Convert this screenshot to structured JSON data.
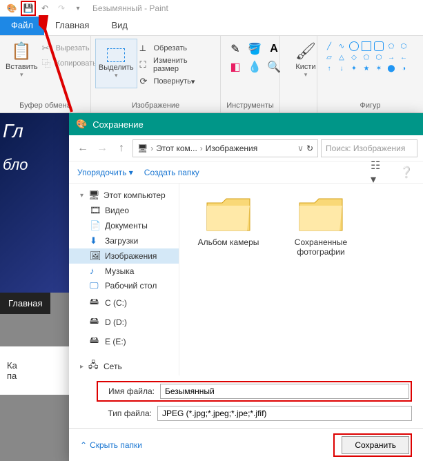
{
  "title": {
    "doc": "Безымянный",
    "app": "Paint"
  },
  "tabs": {
    "file": "Файл",
    "home": "Главная",
    "view": "Вид"
  },
  "ribbon": {
    "clipboard": {
      "paste": "Вставить",
      "cut": "Вырезать",
      "copy": "Копировать",
      "label": "Буфер обмена"
    },
    "image": {
      "select": "Выделить",
      "crop": "Обрезать",
      "resize": "Изменить размер",
      "rotate": "Повернуть",
      "label": "Изображение"
    },
    "tools": {
      "label": "Инструменты"
    },
    "brushes": {
      "label": "Кисти"
    },
    "shapes": {
      "label": "Фигур"
    }
  },
  "canvas": {
    "text1": "Гл",
    "text2": "бло",
    "tab": "Главная",
    "bottom1": "Ка",
    "bottom2": "па"
  },
  "dialog": {
    "title": "Сохранение",
    "breadcrumb": {
      "pc": "Этот ком...",
      "folder": "Изображения"
    },
    "search_placeholder": "Поиск: Изображения",
    "organize": "Упорядочить",
    "new_folder": "Создать папку",
    "tree": {
      "this_pc": "Этот компьютер",
      "videos": "Видео",
      "documents": "Документы",
      "downloads": "Загрузки",
      "pictures": "Изображения",
      "music": "Музыка",
      "desktop": "Рабочий стол",
      "c": "C (C:)",
      "d": "D (D:)",
      "e": "E (E:)",
      "network": "Сеть"
    },
    "folders": {
      "camera": "Альбом камеры",
      "saved": "Сохраненные фотографии"
    },
    "filename_label": "Имя файла:",
    "filename_value": "Безымянный",
    "filetype_label": "Тип файла:",
    "filetype_value": "JPEG (*.jpg;*.jpeg;*.jpe;*.jfif)",
    "hide_folders": "Скрыть папки",
    "save": "Сохранить"
  }
}
